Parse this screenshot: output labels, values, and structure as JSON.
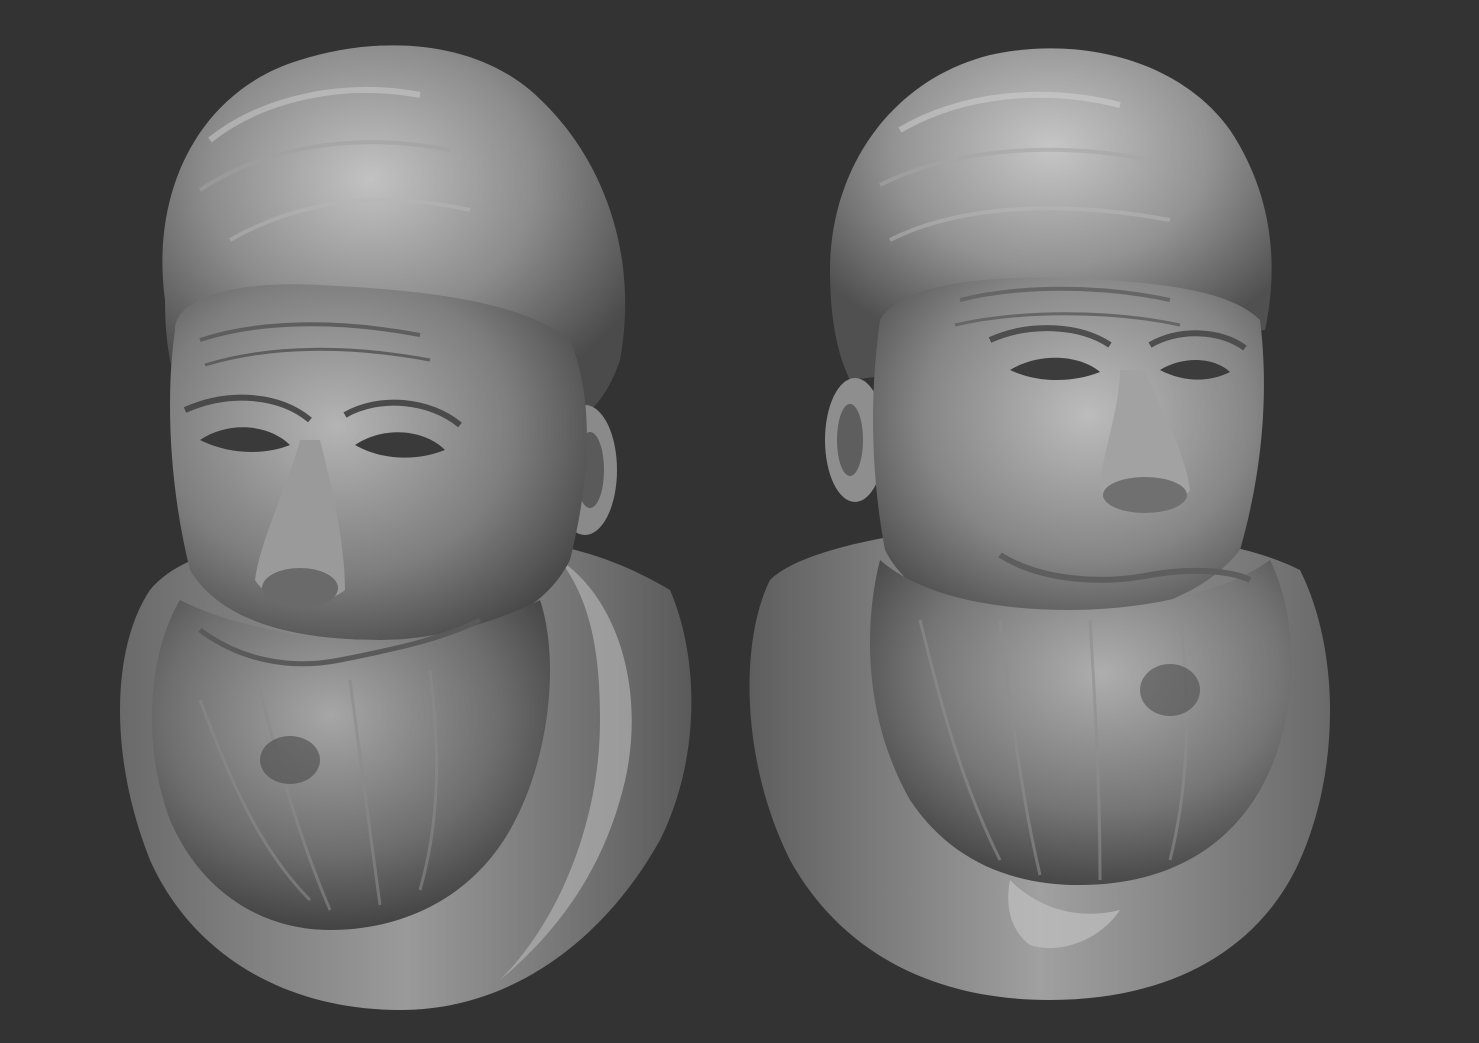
{
  "scene": {
    "background_color": "#333333",
    "subject": "sculpt-bust",
    "material_colors": {
      "highlight": "#c9c9c9",
      "mid": "#8d8d8d",
      "shadow": "#4a4a4a",
      "deep": "#2c2c2c"
    },
    "busts": [
      {
        "view": "three-quarter-left"
      },
      {
        "view": "three-quarter-right"
      }
    ]
  }
}
